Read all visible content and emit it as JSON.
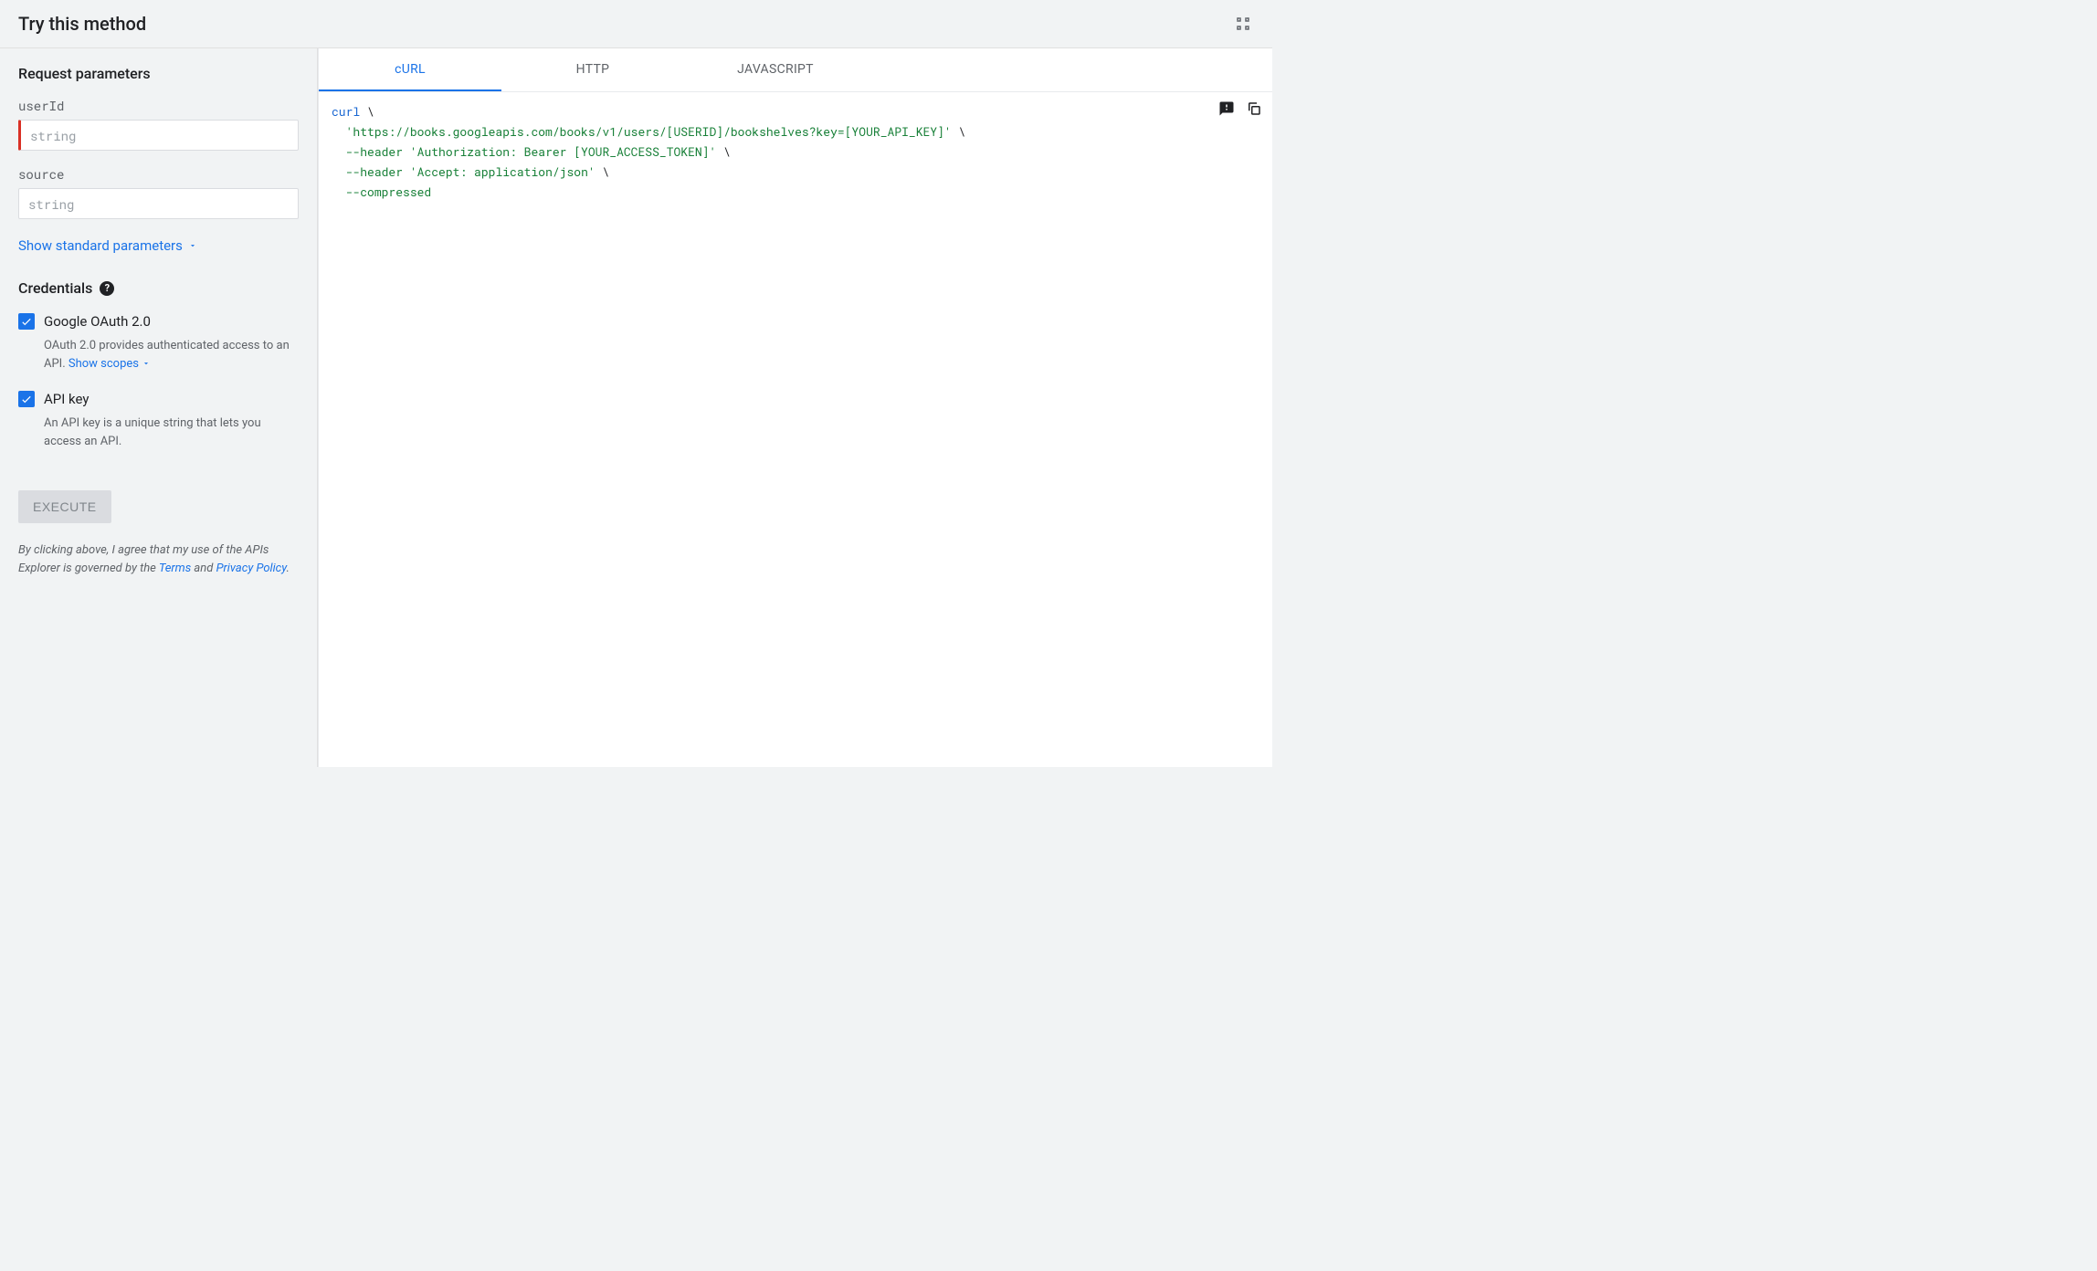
{
  "header": {
    "title": "Try this method"
  },
  "request": {
    "section_title": "Request parameters",
    "params": [
      {
        "name": "userId",
        "placeholder": "string",
        "required": true
      },
      {
        "name": "source",
        "placeholder": "string",
        "required": false
      }
    ],
    "show_standard": "Show standard parameters"
  },
  "credentials": {
    "title": "Credentials",
    "items": [
      {
        "label": "Google OAuth 2.0",
        "checked": true,
        "desc_prefix": "OAuth 2.0 provides authenticated access to an API. ",
        "link_text": "Show scopes",
        "desc_suffix": ""
      },
      {
        "label": "API key",
        "checked": true,
        "desc_prefix": "An API key is a unique string that lets you access an API.",
        "link_text": "",
        "desc_suffix": ""
      }
    ]
  },
  "execute": {
    "label": "Execute",
    "disclaimer_prefix": "By clicking above, I agree that my use of the APIs Explorer is governed by the ",
    "terms": "Terms",
    "and": " and ",
    "privacy": "Privacy Policy",
    "period": "."
  },
  "code_panel": {
    "tabs": [
      "cURL",
      "HTTP",
      "JAVASCRIPT"
    ],
    "active_tab": 0,
    "curl": {
      "cmd": "curl",
      "bs": " \\",
      "line2_url": "'https://books.googleapis.com/books/v1/users/[USERID]/bookshelves?key=[YOUR_API_KEY]'",
      "line3_flag": "--header",
      "line3_val": "'Authorization: Bearer [YOUR_ACCESS_TOKEN]'",
      "line4_flag": "--header",
      "line4_val": "'Accept: application/json'",
      "line5": "--compressed"
    }
  }
}
